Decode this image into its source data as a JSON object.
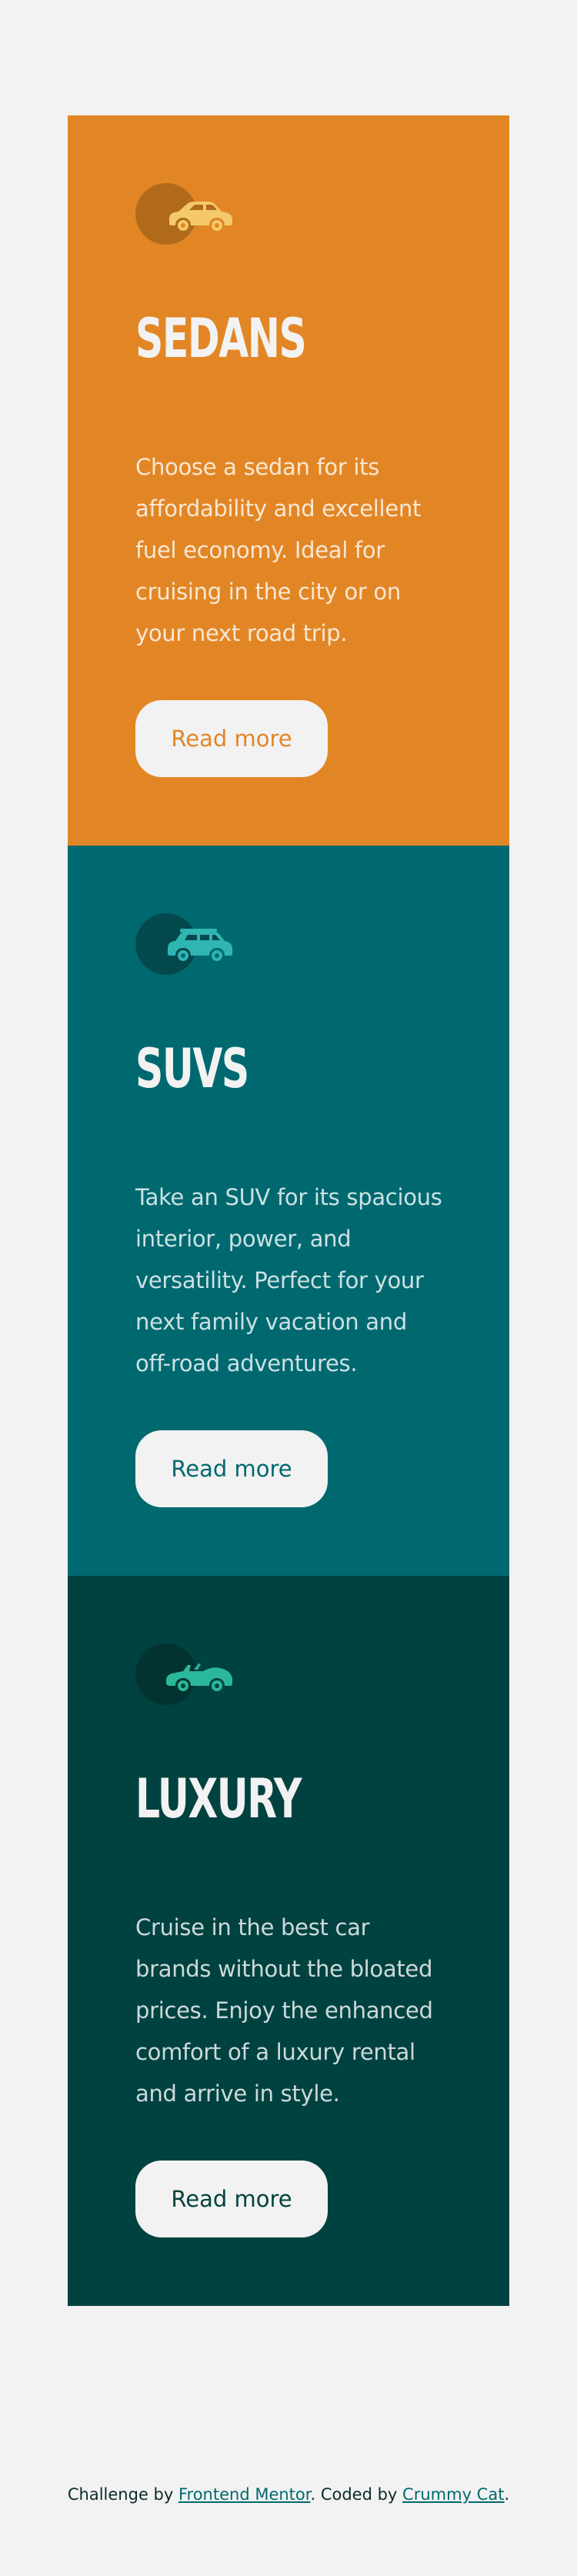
{
  "cards": [
    {
      "id": "sedans",
      "icon": "sedan-car-icon",
      "title": "SEDANS",
      "text": "Choose a sedan for its affordability and excellent fuel economy. Ideal for cruising in the city or on your next road trip.",
      "button_label": "Read more",
      "colors": {
        "background": "#e28625",
        "icon": "#f5c96a"
      }
    },
    {
      "id": "suvs",
      "icon": "suv-car-icon",
      "title": "SUVS",
      "text": "Take an SUV for its spacious interior, power, and versatility. Perfect for your next family vacation and off-road adventures.",
      "button_label": "Read more",
      "colors": {
        "background": "#006970",
        "icon": "#2fb5b2"
      }
    },
    {
      "id": "luxury",
      "icon": "luxury-car-icon",
      "title": "LUXURY",
      "text": "Cruise in the best car brands without the bloated prices. Enjoy the enhanced comfort of a luxury rental and arrive in style.",
      "button_label": "Read more",
      "colors": {
        "background": "#004240",
        "icon": "#2bb89a"
      }
    }
  ],
  "attribution": {
    "prefix": "Challenge by ",
    "link1": "Frontend Mentor",
    "middle": ". Coded by ",
    "link2": "Crummy Cat",
    "suffix": "."
  },
  "colors": {
    "page_background": "#f2f2f2",
    "button_background": "#f2f2f2",
    "link": "#006970"
  }
}
